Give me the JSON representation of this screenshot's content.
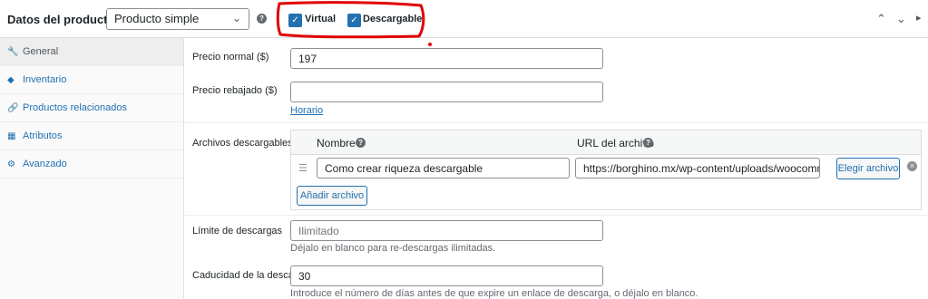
{
  "header": {
    "title": "Datos del producto —",
    "product_type": "Producto simple",
    "help": "?",
    "virtual_label": "Virtual",
    "downloadable_label": "Descargable"
  },
  "sidebar": {
    "items": [
      {
        "label": "General",
        "icon": "wrench-icon"
      },
      {
        "label": "Inventario",
        "icon": "tag-icon"
      },
      {
        "label": "Productos relacionados",
        "icon": "link-icon"
      },
      {
        "label": "Atributos",
        "icon": "table-icon"
      },
      {
        "label": "Avanzado",
        "icon": "gear-icon"
      }
    ]
  },
  "general": {
    "regular_price_label": "Precio normal ($)",
    "regular_price_value": "197",
    "sale_price_label": "Precio rebajado ($)",
    "sale_price_value": "",
    "schedule_link": "Horario",
    "downloadable_files_label": "Archivos descargables",
    "col_name": "Nombre",
    "col_url": "URL del archivo",
    "file_name": "Como crear riqueza descargable",
    "file_url": "https://borghino.mx/wp-content/uploads/woocommerce",
    "choose_file": "Elegir archivo",
    "add_file": "Añadir archivo",
    "download_limit_label": "Límite de descargas",
    "download_limit_placeholder": "Ilimitado",
    "download_limit_desc": "Déjalo en blanco para re-descargas ilimitadas.",
    "download_expiry_label": "Caducidad de la descarga",
    "download_expiry_value": "30",
    "download_expiry_desc": "Introduce el número de días antes de que expire un enlace de descarga, o déjalo en blanco."
  },
  "colors": {
    "accent": "#2271b1",
    "annotation": "#e00000"
  }
}
